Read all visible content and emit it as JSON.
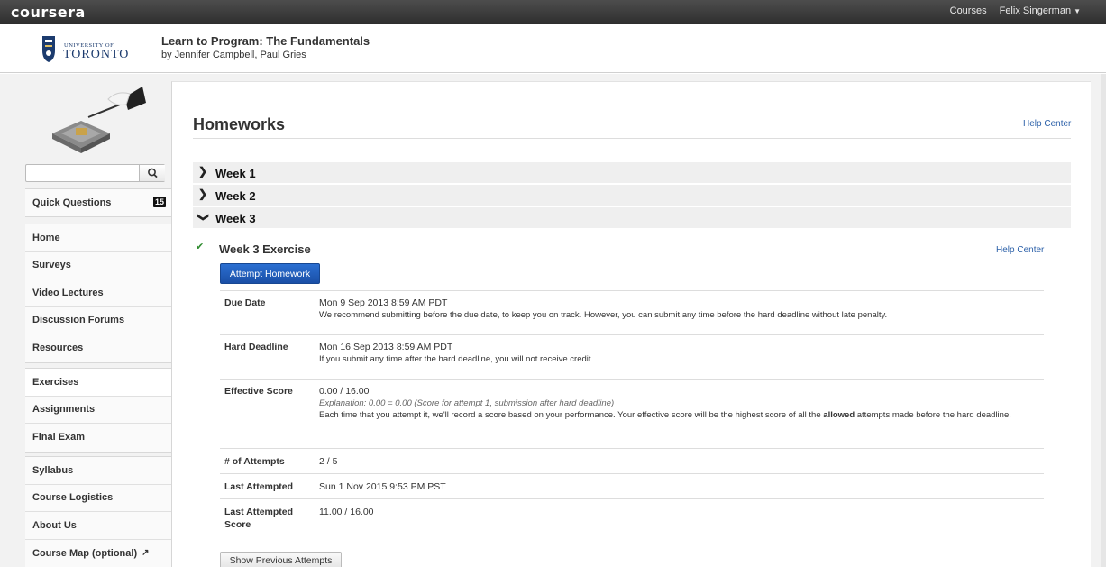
{
  "topbar": {
    "brand": "coursera",
    "courses_link": "Courses",
    "user_name": "Felix Singerman"
  },
  "course": {
    "university_line1": "UNIVERSITY OF",
    "university_line2": "TORONTO",
    "title": "Learn to Program: The Fundamentals",
    "authors": "by Jennifer Campbell, Paul Gries"
  },
  "sidebar": {
    "search_placeholder": "",
    "quick_questions": {
      "label": "Quick Questions",
      "badge": "15"
    },
    "group1": [
      "Home",
      "Surveys",
      "Video Lectures",
      "Discussion Forums",
      "Resources"
    ],
    "group2": [
      "Exercises",
      "Assignments",
      "Final Exam"
    ],
    "group3": [
      "Syllabus",
      "Course Logistics",
      "About Us",
      "Course Map (optional)"
    ],
    "active_item": "Exercises"
  },
  "main": {
    "title": "Homeworks",
    "help_center": "Help Center",
    "weeks": [
      {
        "label": "Week 1",
        "expanded": false
      },
      {
        "label": "Week 2",
        "expanded": false
      },
      {
        "label": "Week 3",
        "expanded": true
      }
    ],
    "exercise": {
      "title": "Week 3 Exercise",
      "help_center": "Help Center",
      "attempt_button": "Attempt Homework",
      "due_date": {
        "label": "Due Date",
        "value": "Mon 9 Sep 2013 8:59 AM PDT",
        "note": "We recommend submitting before the due date, to keep you on track. However, you can submit any time before the hard deadline without late penalty."
      },
      "hard_deadline": {
        "label": "Hard Deadline",
        "value": "Mon 16 Sep 2013 8:59 AM PDT",
        "note": "If you submit any time after the hard deadline, you will not receive credit."
      },
      "effective_score": {
        "label": "Effective Score",
        "value": "0.00 / 16.00",
        "explanation": "Explanation: 0.00 = 0.00 (Score for attempt 1, submission after hard deadline)",
        "note_before": "Each time that you attempt it, we'll record a score based on your performance. Your effective score will be the highest score of all the ",
        "note_bold": "allowed",
        "note_after": " attempts made before the hard deadline."
      },
      "attempts": {
        "label": "# of Attempts",
        "value": "2 / 5"
      },
      "last_attempted": {
        "label": "Last Attempted",
        "value": "Sun 1 Nov 2015 9:53 PM PST"
      },
      "last_attempted_score": {
        "label_line1": "Last Attempted",
        "label_line2": "Score",
        "value": "11.00 / 16.00"
      },
      "show_previous_button": "Show Previous Attempts"
    }
  }
}
